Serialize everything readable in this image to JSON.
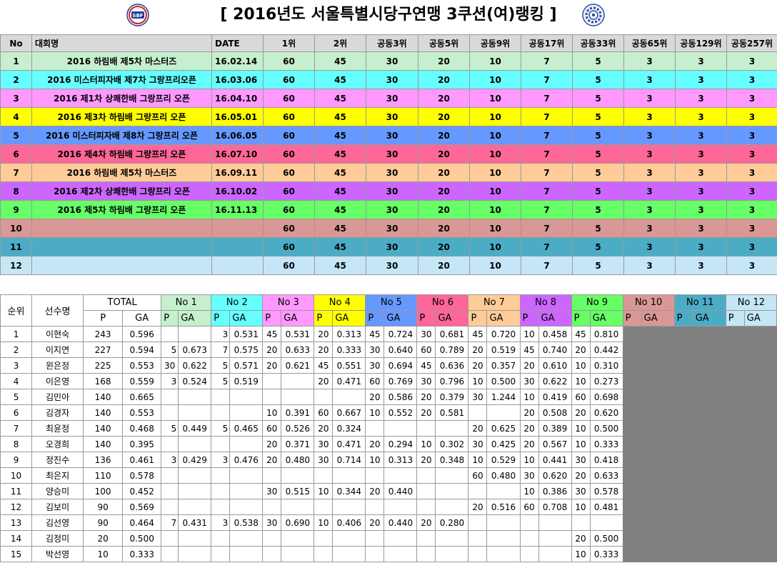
{
  "title": "[ 2016년도 서울특별시당구연맹 3쿠션(여)랭킹 ]",
  "top_table": {
    "headers": [
      "No",
      "대회명",
      "DATE",
      "1위",
      "2위",
      "공동3위",
      "공동5위",
      "공동9위",
      "공동17위",
      "공동33위",
      "공동65위",
      "공동129위",
      "공동257위"
    ],
    "points": [
      "60",
      "45",
      "30",
      "20",
      "10",
      "7",
      "5",
      "3",
      "3",
      "3"
    ],
    "rows": [
      {
        "no": "1",
        "name": "2016 하림배 제5차 마스터즈",
        "date": "16.02.14",
        "color": "#c6efce"
      },
      {
        "no": "2",
        "name": "2016 미스터피자배 제7차 그랑프리오픈",
        "date": "16.03.06",
        "color": "#66ffff"
      },
      {
        "no": "3",
        "name": "2016 제1차 상쾌한배 그랑프리 오픈",
        "date": "16.04.10",
        "color": "#ff99ff"
      },
      {
        "no": "4",
        "name": "2016 제3차 하림배 그랑프리 오픈",
        "date": "16.05.01",
        "color": "#ffff00"
      },
      {
        "no": "5",
        "name": "2016 미스터피자배 제8차 그랑프리 오픈",
        "date": "16.06.05",
        "color": "#6699ff"
      },
      {
        "no": "6",
        "name": "2016 제4차 하림배 그랑프리 오픈",
        "date": "16.07.10",
        "color": "#ff6699"
      },
      {
        "no": "7",
        "name": "2016 하림배 제5차 마스터즈",
        "date": "16.09.11",
        "color": "#ffcc99"
      },
      {
        "no": "8",
        "name": "2016 제2차 상쾌한배 그랑프리 오픈",
        "date": "16.10.02",
        "color": "#cc66ff"
      },
      {
        "no": "9",
        "name": "2016 제5차 하림배 그랑프리 오픈",
        "date": "16.11.13",
        "color": "#66ff66"
      },
      {
        "no": "10",
        "name": "",
        "date": "",
        "color": "#d99795"
      },
      {
        "no": "11",
        "name": "",
        "date": "",
        "color": "#4bacc6"
      },
      {
        "no": "12",
        "name": "",
        "date": "",
        "color": "#c5e6f7"
      }
    ]
  },
  "bottom_table": {
    "header_rank": "순위",
    "header_player": "선수명",
    "header_total": "TOTAL",
    "header_p": "P",
    "header_ga": "GA",
    "tournaments": [
      {
        "label": "No 1",
        "color": "#c6efce"
      },
      {
        "label": "No 2",
        "color": "#66ffff"
      },
      {
        "label": "No 3",
        "color": "#ff99ff"
      },
      {
        "label": "No 4",
        "color": "#ffff00"
      },
      {
        "label": "No 5",
        "color": "#6699ff"
      },
      {
        "label": "No 6",
        "color": "#ff6699"
      },
      {
        "label": "No 7",
        "color": "#ffcc99"
      },
      {
        "label": "No 8",
        "color": "#cc66ff"
      },
      {
        "label": "No 9",
        "color": "#66ff66"
      },
      {
        "label": "No 10",
        "color": "#d99795"
      },
      {
        "label": "No 11",
        "color": "#4bacc6"
      },
      {
        "label": "No 12",
        "color": "#c5e6f7"
      }
    ],
    "rows": [
      {
        "rank": "1",
        "name": "이현숙",
        "total_p": "243",
        "total_ga": "0.596",
        "results": [
          [
            "",
            ""
          ],
          [
            "3",
            "0.531"
          ],
          [
            "45",
            "0.531"
          ],
          [
            "20",
            "0.313"
          ],
          [
            "45",
            "0.724"
          ],
          [
            "30",
            "0.681"
          ],
          [
            "45",
            "0.720"
          ],
          [
            "10",
            "0.458"
          ],
          [
            "45",
            "0.810"
          ]
        ]
      },
      {
        "rank": "2",
        "name": "이지연",
        "total_p": "227",
        "total_ga": "0.594",
        "results": [
          [
            "5",
            "0.673"
          ],
          [
            "7",
            "0.575"
          ],
          [
            "20",
            "0.633"
          ],
          [
            "20",
            "0.333"
          ],
          [
            "30",
            "0.640"
          ],
          [
            "60",
            "0.789"
          ],
          [
            "20",
            "0.519"
          ],
          [
            "45",
            "0.740"
          ],
          [
            "20",
            "0.442"
          ]
        ]
      },
      {
        "rank": "3",
        "name": "윈은정",
        "total_p": "225",
        "total_ga": "0.553",
        "results": [
          [
            "30",
            "0.622"
          ],
          [
            "5",
            "0.571"
          ],
          [
            "20",
            "0.621"
          ],
          [
            "45",
            "0.551"
          ],
          [
            "30",
            "0.694"
          ],
          [
            "45",
            "0.636"
          ],
          [
            "20",
            "0.357"
          ],
          [
            "20",
            "0.610"
          ],
          [
            "10",
            "0.310"
          ]
        ]
      },
      {
        "rank": "4",
        "name": "이은영",
        "total_p": "168",
        "total_ga": "0.559",
        "results": [
          [
            "3",
            "0.524"
          ],
          [
            "5",
            "0.519"
          ],
          [
            "",
            ""
          ],
          [
            "20",
            "0.471"
          ],
          [
            "60",
            "0.769"
          ],
          [
            "30",
            "0.796"
          ],
          [
            "10",
            "0.500"
          ],
          [
            "30",
            "0.622"
          ],
          [
            "10",
            "0.273"
          ]
        ]
      },
      {
        "rank": "5",
        "name": "김민아",
        "total_p": "140",
        "total_ga": "0.665",
        "results": [
          [
            "",
            ""
          ],
          [
            "",
            ""
          ],
          [
            "",
            ""
          ],
          [
            "",
            ""
          ],
          [
            "20",
            "0.586"
          ],
          [
            "20",
            "0.379"
          ],
          [
            "30",
            "1.244"
          ],
          [
            "10",
            "0.419"
          ],
          [
            "60",
            "0.698"
          ]
        ]
      },
      {
        "rank": "6",
        "name": "김경자",
        "total_p": "140",
        "total_ga": "0.553",
        "results": [
          [
            "",
            ""
          ],
          [
            "",
            ""
          ],
          [
            "10",
            "0.391"
          ],
          [
            "60",
            "0.667"
          ],
          [
            "10",
            "0.552"
          ],
          [
            "20",
            "0.581"
          ],
          [
            "",
            ""
          ],
          [
            "20",
            "0.508"
          ],
          [
            "20",
            "0.620"
          ]
        ]
      },
      {
        "rank": "7",
        "name": "최윤정",
        "total_p": "140",
        "total_ga": "0.468",
        "results": [
          [
            "5",
            "0.449"
          ],
          [
            "5",
            "0.465"
          ],
          [
            "60",
            "0.526"
          ],
          [
            "20",
            "0.324"
          ],
          [
            "",
            ""
          ],
          [
            "",
            ""
          ],
          [
            "20",
            "0.625"
          ],
          [
            "20",
            "0.389"
          ],
          [
            "10",
            "0.500"
          ]
        ]
      },
      {
        "rank": "8",
        "name": "오경희",
        "total_p": "140",
        "total_ga": "0.395",
        "results": [
          [
            "",
            ""
          ],
          [
            "",
            ""
          ],
          [
            "20",
            "0.371"
          ],
          [
            "30",
            "0.471"
          ],
          [
            "20",
            "0.294"
          ],
          [
            "10",
            "0.302"
          ],
          [
            "30",
            "0.425"
          ],
          [
            "20",
            "0.567"
          ],
          [
            "10",
            "0.333"
          ]
        ]
      },
      {
        "rank": "9",
        "name": "정진수",
        "total_p": "136",
        "total_ga": "0.461",
        "results": [
          [
            "3",
            "0.429"
          ],
          [
            "3",
            "0.476"
          ],
          [
            "20",
            "0.480"
          ],
          [
            "30",
            "0.714"
          ],
          [
            "10",
            "0.313"
          ],
          [
            "20",
            "0.348"
          ],
          [
            "10",
            "0.529"
          ],
          [
            "10",
            "0.441"
          ],
          [
            "30",
            "0.418"
          ]
        ]
      },
      {
        "rank": "10",
        "name": "최은지",
        "total_p": "110",
        "total_ga": "0.578",
        "results": [
          [
            "",
            ""
          ],
          [
            "",
            ""
          ],
          [
            "",
            ""
          ],
          [
            "",
            ""
          ],
          [
            "",
            ""
          ],
          [
            "",
            ""
          ],
          [
            "60",
            "0.480"
          ],
          [
            "30",
            "0.620"
          ],
          [
            "20",
            "0.633"
          ]
        ]
      },
      {
        "rank": "11",
        "name": "양승미",
        "total_p": "100",
        "total_ga": "0.452",
        "results": [
          [
            "",
            ""
          ],
          [
            "",
            ""
          ],
          [
            "30",
            "0.515"
          ],
          [
            "10",
            "0.344"
          ],
          [
            "20",
            "0.440"
          ],
          [
            "",
            ""
          ],
          [
            "",
            ""
          ],
          [
            "10",
            "0.386"
          ],
          [
            "30",
            "0.578"
          ]
        ]
      },
      {
        "rank": "12",
        "name": "김보미",
        "total_p": "90",
        "total_ga": "0.569",
        "results": [
          [
            "",
            ""
          ],
          [
            "",
            ""
          ],
          [
            "",
            ""
          ],
          [
            "",
            ""
          ],
          [
            "",
            ""
          ],
          [
            "",
            ""
          ],
          [
            "20",
            "0.516"
          ],
          [
            "60",
            "0.708"
          ],
          [
            "10",
            "0.481"
          ]
        ]
      },
      {
        "rank": "13",
        "name": "김선영",
        "total_p": "90",
        "total_ga": "0.464",
        "results": [
          [
            "7",
            "0.431"
          ],
          [
            "3",
            "0.538"
          ],
          [
            "30",
            "0.690"
          ],
          [
            "10",
            "0.406"
          ],
          [
            "20",
            "0.440"
          ],
          [
            "20",
            "0.280"
          ],
          [
            "",
            ""
          ],
          [
            "",
            ""
          ],
          [
            "",
            ""
          ]
        ]
      },
      {
        "rank": "14",
        "name": "김정미",
        "total_p": "20",
        "total_ga": "0.500",
        "results": [
          [
            "",
            ""
          ],
          [
            "",
            ""
          ],
          [
            "",
            ""
          ],
          [
            "",
            ""
          ],
          [
            "",
            ""
          ],
          [
            "",
            ""
          ],
          [
            "",
            ""
          ],
          [
            "",
            ""
          ],
          [
            "20",
            "0.500"
          ]
        ]
      },
      {
        "rank": "15",
        "name": "박선영",
        "total_p": "10",
        "total_ga": "0.333",
        "results": [
          [
            "",
            ""
          ],
          [
            "",
            ""
          ],
          [
            "",
            ""
          ],
          [
            "",
            ""
          ],
          [
            "",
            ""
          ],
          [
            "",
            ""
          ],
          [
            "",
            ""
          ],
          [
            "",
            ""
          ],
          [
            "10",
            "0.333"
          ]
        ]
      }
    ]
  },
  "logos": {
    "left": "SBF",
    "right_icon": "gear-emblem-icon"
  },
  "colors": {
    "header_gray": "#d9d9d9",
    "grid": "#9a9a9a",
    "empty_gray": "#808080"
  }
}
